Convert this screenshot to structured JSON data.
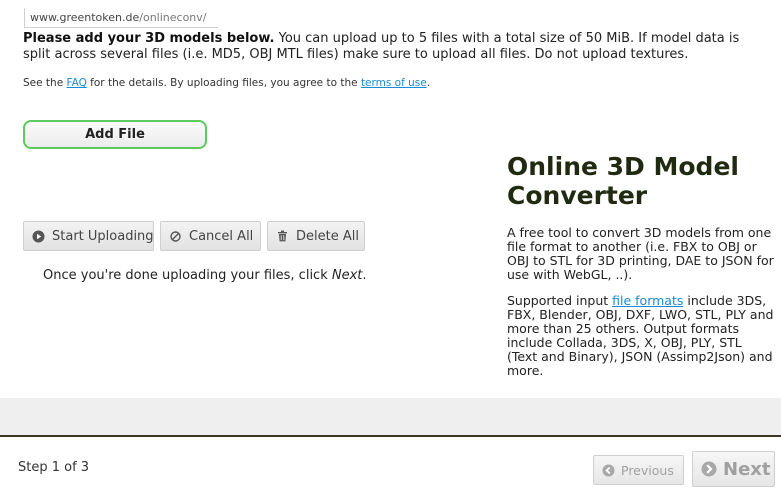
{
  "url_bar": {
    "host": "www.greentoken.de",
    "path": "/onlineconv/"
  },
  "intro": {
    "bold": "Please add your 3D models below.",
    "rest": " You can upload up to 5 files with a total size of 50 MiB. If model data is split across several files (i.e. MD5, OBJ MTL files) make sure to upload all files. Do not upload textures."
  },
  "faq_line": {
    "part1": "See the ",
    "faq_link": "FAQ",
    "part2": " for the details. By uploading files, you agree to the ",
    "terms_link": "terms of use",
    "part3": "."
  },
  "uploader": {
    "add_file": "Add File",
    "start_uploading": "Start Uploading",
    "cancel_all": "Cancel All",
    "delete_all": "Delete All",
    "hint_prefix": "Once you're done uploading your files, click ",
    "hint_next": "Next",
    "hint_suffix": "."
  },
  "side": {
    "title": "Online 3D Model Converter",
    "description": "A free tool to convert 3D models from one file format to another (i.e. FBX to OBJ or OBJ to STL for 3D printing, DAE to JSON for use with WebGL, ..).",
    "formats_prefix": "Supported input ",
    "formats_link": "file formats",
    "formats_rest": " include 3DS, FBX, Blender, OBJ, DXF, LWO, STL, PLY and more than 25 others. Output formats include Collada, 3DS, X, OBJ, PLY, STL (Text and Binary), JSON (Assimp2Json) and more."
  },
  "footer": {
    "step": "Step 1 of 3",
    "previous": "Previous",
    "next": "Next"
  },
  "colors": {
    "accent_green": "#5ccb5f",
    "link_blue": "#1a8bd1",
    "title_dark": "#1f2a10",
    "disabled_gray": "#a0a0a0"
  },
  "icons": {
    "start": "play-circle-icon",
    "cancel": "ban-icon",
    "delete": "trash-icon",
    "previous": "arrow-left-circle-icon",
    "next": "arrow-right-circle-icon"
  }
}
